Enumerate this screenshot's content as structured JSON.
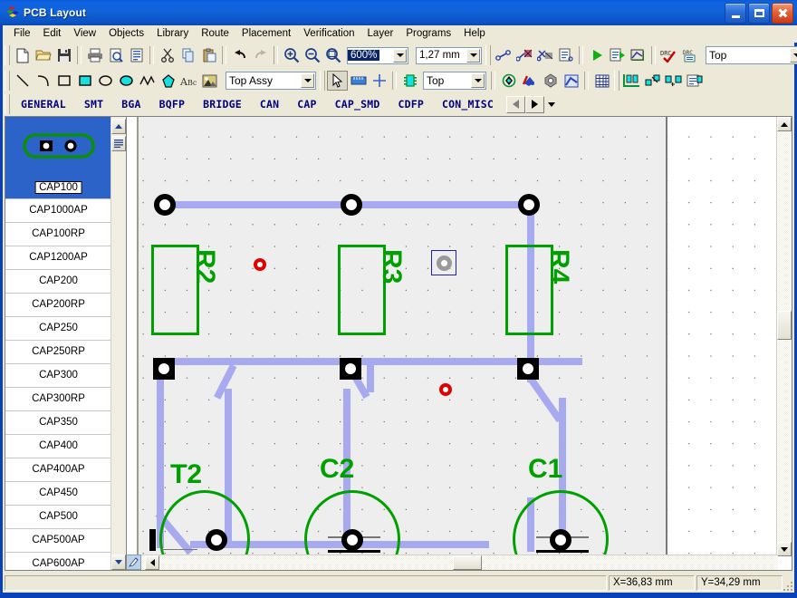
{
  "window": {
    "title": "PCB Layout",
    "icon": "pcb-app-icon",
    "buttons": {
      "minimize": "Minimize",
      "maximize": "Maximize",
      "close": "Close"
    }
  },
  "menu": {
    "items": [
      {
        "label": "File",
        "name": "menu-file"
      },
      {
        "label": "Edit",
        "name": "menu-edit"
      },
      {
        "label": "View",
        "name": "menu-view"
      },
      {
        "label": "Objects",
        "name": "menu-objects"
      },
      {
        "label": "Library",
        "name": "menu-library"
      },
      {
        "label": "Route",
        "name": "menu-route"
      },
      {
        "label": "Placement",
        "name": "menu-placement"
      },
      {
        "label": "Verification",
        "name": "menu-verification"
      },
      {
        "label": "Layer",
        "name": "menu-layer"
      },
      {
        "label": "Programs",
        "name": "menu-programs"
      },
      {
        "label": "Help",
        "name": "menu-help"
      }
    ]
  },
  "toolbar_main": {
    "buttons": [
      {
        "name": "new-file-button",
        "icon": "new-document-icon",
        "title": "New"
      },
      {
        "name": "open-file-button",
        "icon": "open-folder-icon",
        "title": "Open"
      },
      {
        "name": "save-file-button",
        "icon": "floppy-save-icon",
        "title": "Save"
      },
      {
        "name": "print-button",
        "icon": "printer-icon",
        "title": "Print"
      },
      {
        "name": "print-preview-button",
        "icon": "print-preview-icon",
        "title": "Print Preview"
      },
      {
        "name": "report-button",
        "icon": "document-lines-icon",
        "title": "Report"
      },
      {
        "name": "cut-button",
        "icon": "scissors-icon",
        "title": "Cut"
      },
      {
        "name": "copy-button",
        "icon": "copy-icon",
        "title": "Copy"
      },
      {
        "name": "paste-button",
        "icon": "paste-clipboard-icon",
        "title": "Paste"
      },
      {
        "name": "undo-button",
        "icon": "undo-arrow-icon",
        "title": "Undo"
      },
      {
        "name": "redo-button",
        "icon": "redo-arrow-icon",
        "title": "Redo"
      },
      {
        "name": "zoom-in-button",
        "icon": "magnifier-plus-icon",
        "title": "Zoom In"
      },
      {
        "name": "zoom-out-button",
        "icon": "magnifier-minus-icon",
        "title": "Zoom Out"
      },
      {
        "name": "zoom-window-button",
        "icon": "magnifier-window-icon",
        "title": "Zoom Window"
      }
    ],
    "zoom_combo": {
      "name": "zoom-level-combo",
      "value": "600%",
      "selected": true
    },
    "grid_combo": {
      "name": "grid-step-combo",
      "value": "1,27 mm"
    },
    "route_buttons": [
      {
        "name": "route-trace-button",
        "icon": "trace-route-icon",
        "title": "Route trace"
      },
      {
        "name": "route-manual-button",
        "icon": "trace-manual-icon",
        "title": "Manual route"
      },
      {
        "name": "route-delete-button",
        "icon": "trace-delete-icon",
        "title": "Delete route"
      },
      {
        "name": "route-properties-button",
        "icon": "route-properties-icon",
        "title": "Route properties"
      },
      {
        "name": "run-autoroute-button",
        "icon": "play-green-icon",
        "title": "Run"
      },
      {
        "name": "run-script-button",
        "icon": "script-run-icon",
        "title": "Run script"
      },
      {
        "name": "copper-pour-button",
        "icon": "copper-pour-icon",
        "title": "Copper pour"
      },
      {
        "name": "drc-check-button",
        "icon": "drc-check-icon",
        "title": "DRC check"
      },
      {
        "name": "drc-report-button",
        "icon": "drc-report-icon",
        "title": "DRC report"
      }
    ],
    "layer_combo": {
      "name": "active-layer-combo",
      "value": "Top"
    }
  },
  "toolbar_draw": {
    "buttons": [
      {
        "name": "draw-line-button",
        "icon": "line-icon",
        "title": "Line"
      },
      {
        "name": "draw-arc-button",
        "icon": "arc-icon",
        "title": "Arc"
      },
      {
        "name": "draw-rect-button",
        "icon": "rectangle-outline-icon",
        "title": "Rectangle"
      },
      {
        "name": "draw-rect-filled-button",
        "icon": "rectangle-filled-icon",
        "title": "Filled rectangle"
      },
      {
        "name": "draw-ellipse-button",
        "icon": "ellipse-outline-icon",
        "title": "Ellipse"
      },
      {
        "name": "draw-ellipse-filled-button",
        "icon": "ellipse-filled-icon",
        "title": "Filled ellipse"
      },
      {
        "name": "draw-polyline-button",
        "icon": "polyline-icon",
        "title": "Polyline"
      },
      {
        "name": "draw-polygon-button",
        "icon": "polygon-filled-icon",
        "title": "Polygon"
      },
      {
        "name": "draw-text-button",
        "icon": "text-abc-icon",
        "title": "Text"
      },
      {
        "name": "draw-image-button",
        "icon": "image-icon",
        "title": "Image"
      }
    ],
    "draw_layer_combo": {
      "name": "draw-layer-combo",
      "value": "Top Assy"
    },
    "tool_buttons": [
      {
        "name": "select-tool-button",
        "icon": "arrow-cursor-icon",
        "title": "Select",
        "pressed": true
      },
      {
        "name": "measure-tool-button",
        "icon": "ruler-icon",
        "title": "Measure"
      },
      {
        "name": "origin-tool-button",
        "icon": "crosshair-icon",
        "title": "Origin"
      }
    ],
    "component_button": {
      "name": "place-component-button",
      "icon": "chip-icon",
      "title": "Place component"
    },
    "component_layer_combo": {
      "name": "component-layer-combo",
      "value": "Top"
    },
    "object_buttons": [
      {
        "name": "place-pad-button",
        "icon": "pad-icon",
        "title": "Pad"
      },
      {
        "name": "place-connection-button",
        "icon": "connection-icon",
        "title": "Connection"
      },
      {
        "name": "place-via-button",
        "icon": "via-icon",
        "title": "Via"
      },
      {
        "name": "place-zone-button",
        "icon": "zone-icon",
        "title": "Zone"
      },
      {
        "name": "grid-toggle-button",
        "icon": "grid-table-icon",
        "title": "Grid"
      }
    ],
    "panel_buttons": [
      {
        "name": "components-panel-button",
        "icon": "components-list-icon",
        "title": "Components"
      },
      {
        "name": "swap-pins-button",
        "icon": "swap-pins-icon",
        "title": "Swap pins"
      },
      {
        "name": "swap-components-button",
        "icon": "swap-components-icon",
        "title": "Swap components"
      },
      {
        "name": "component-properties-button",
        "icon": "component-properties-icon",
        "title": "Component properties"
      }
    ]
  },
  "category_tabs": {
    "items": [
      {
        "label": "GENERAL",
        "name": "tab-general"
      },
      {
        "label": "SMT",
        "name": "tab-smt"
      },
      {
        "label": "BGA",
        "name": "tab-bga"
      },
      {
        "label": "BQFP",
        "name": "tab-bqfp"
      },
      {
        "label": "BRIDGE",
        "name": "tab-bridge"
      },
      {
        "label": "CAN",
        "name": "tab-can"
      },
      {
        "label": "CAP",
        "name": "tab-cap"
      },
      {
        "label": "CAP_SMD",
        "name": "tab-cap-smd"
      },
      {
        "label": "CDFP",
        "name": "tab-cdfp"
      },
      {
        "label": "CON_MISC",
        "name": "tab-con-misc"
      }
    ],
    "nav": {
      "prev": "scroll-tabs-left",
      "next": "scroll-tabs-right",
      "more": "tabs-dropdown"
    }
  },
  "library_panel": {
    "selected": {
      "label": "CAP100",
      "preview": "capacitor-footprint-2-pad"
    },
    "items": [
      {
        "label": "CAP1000AP"
      },
      {
        "label": "CAP100RP"
      },
      {
        "label": "CAP1200AP"
      },
      {
        "label": "CAP200"
      },
      {
        "label": "CAP200RP"
      },
      {
        "label": "CAP250"
      },
      {
        "label": "CAP250RP"
      },
      {
        "label": "CAP300"
      },
      {
        "label": "CAP300RP"
      },
      {
        "label": "CAP350"
      },
      {
        "label": "CAP400"
      },
      {
        "label": "CAP400AP"
      },
      {
        "label": "CAP450"
      },
      {
        "label": "CAP500"
      },
      {
        "label": "CAP500AP"
      },
      {
        "label": "CAP600AP"
      }
    ],
    "scroll": {
      "up": "library-scroll-up",
      "list": "library-list-button"
    }
  },
  "canvas": {
    "name": "pcb-canvas",
    "components": [
      {
        "ref": "R2",
        "name": "component-r2"
      },
      {
        "ref": "R3",
        "name": "component-r3"
      },
      {
        "ref": "R4",
        "name": "component-r4"
      },
      {
        "ref": "T2",
        "name": "component-t2"
      },
      {
        "ref": "C2",
        "name": "component-c2"
      },
      {
        "ref": "C1",
        "name": "component-c1"
      }
    ],
    "colors": {
      "silkscreen": "#00a000",
      "trace": "#a8aaf0",
      "pad": "#000000",
      "via": "#e00000",
      "board": "#eeeeee",
      "selection": "#2222aa"
    }
  },
  "status_bar": {
    "x": "X=36,83 mm",
    "y": "Y=34,29 mm"
  }
}
